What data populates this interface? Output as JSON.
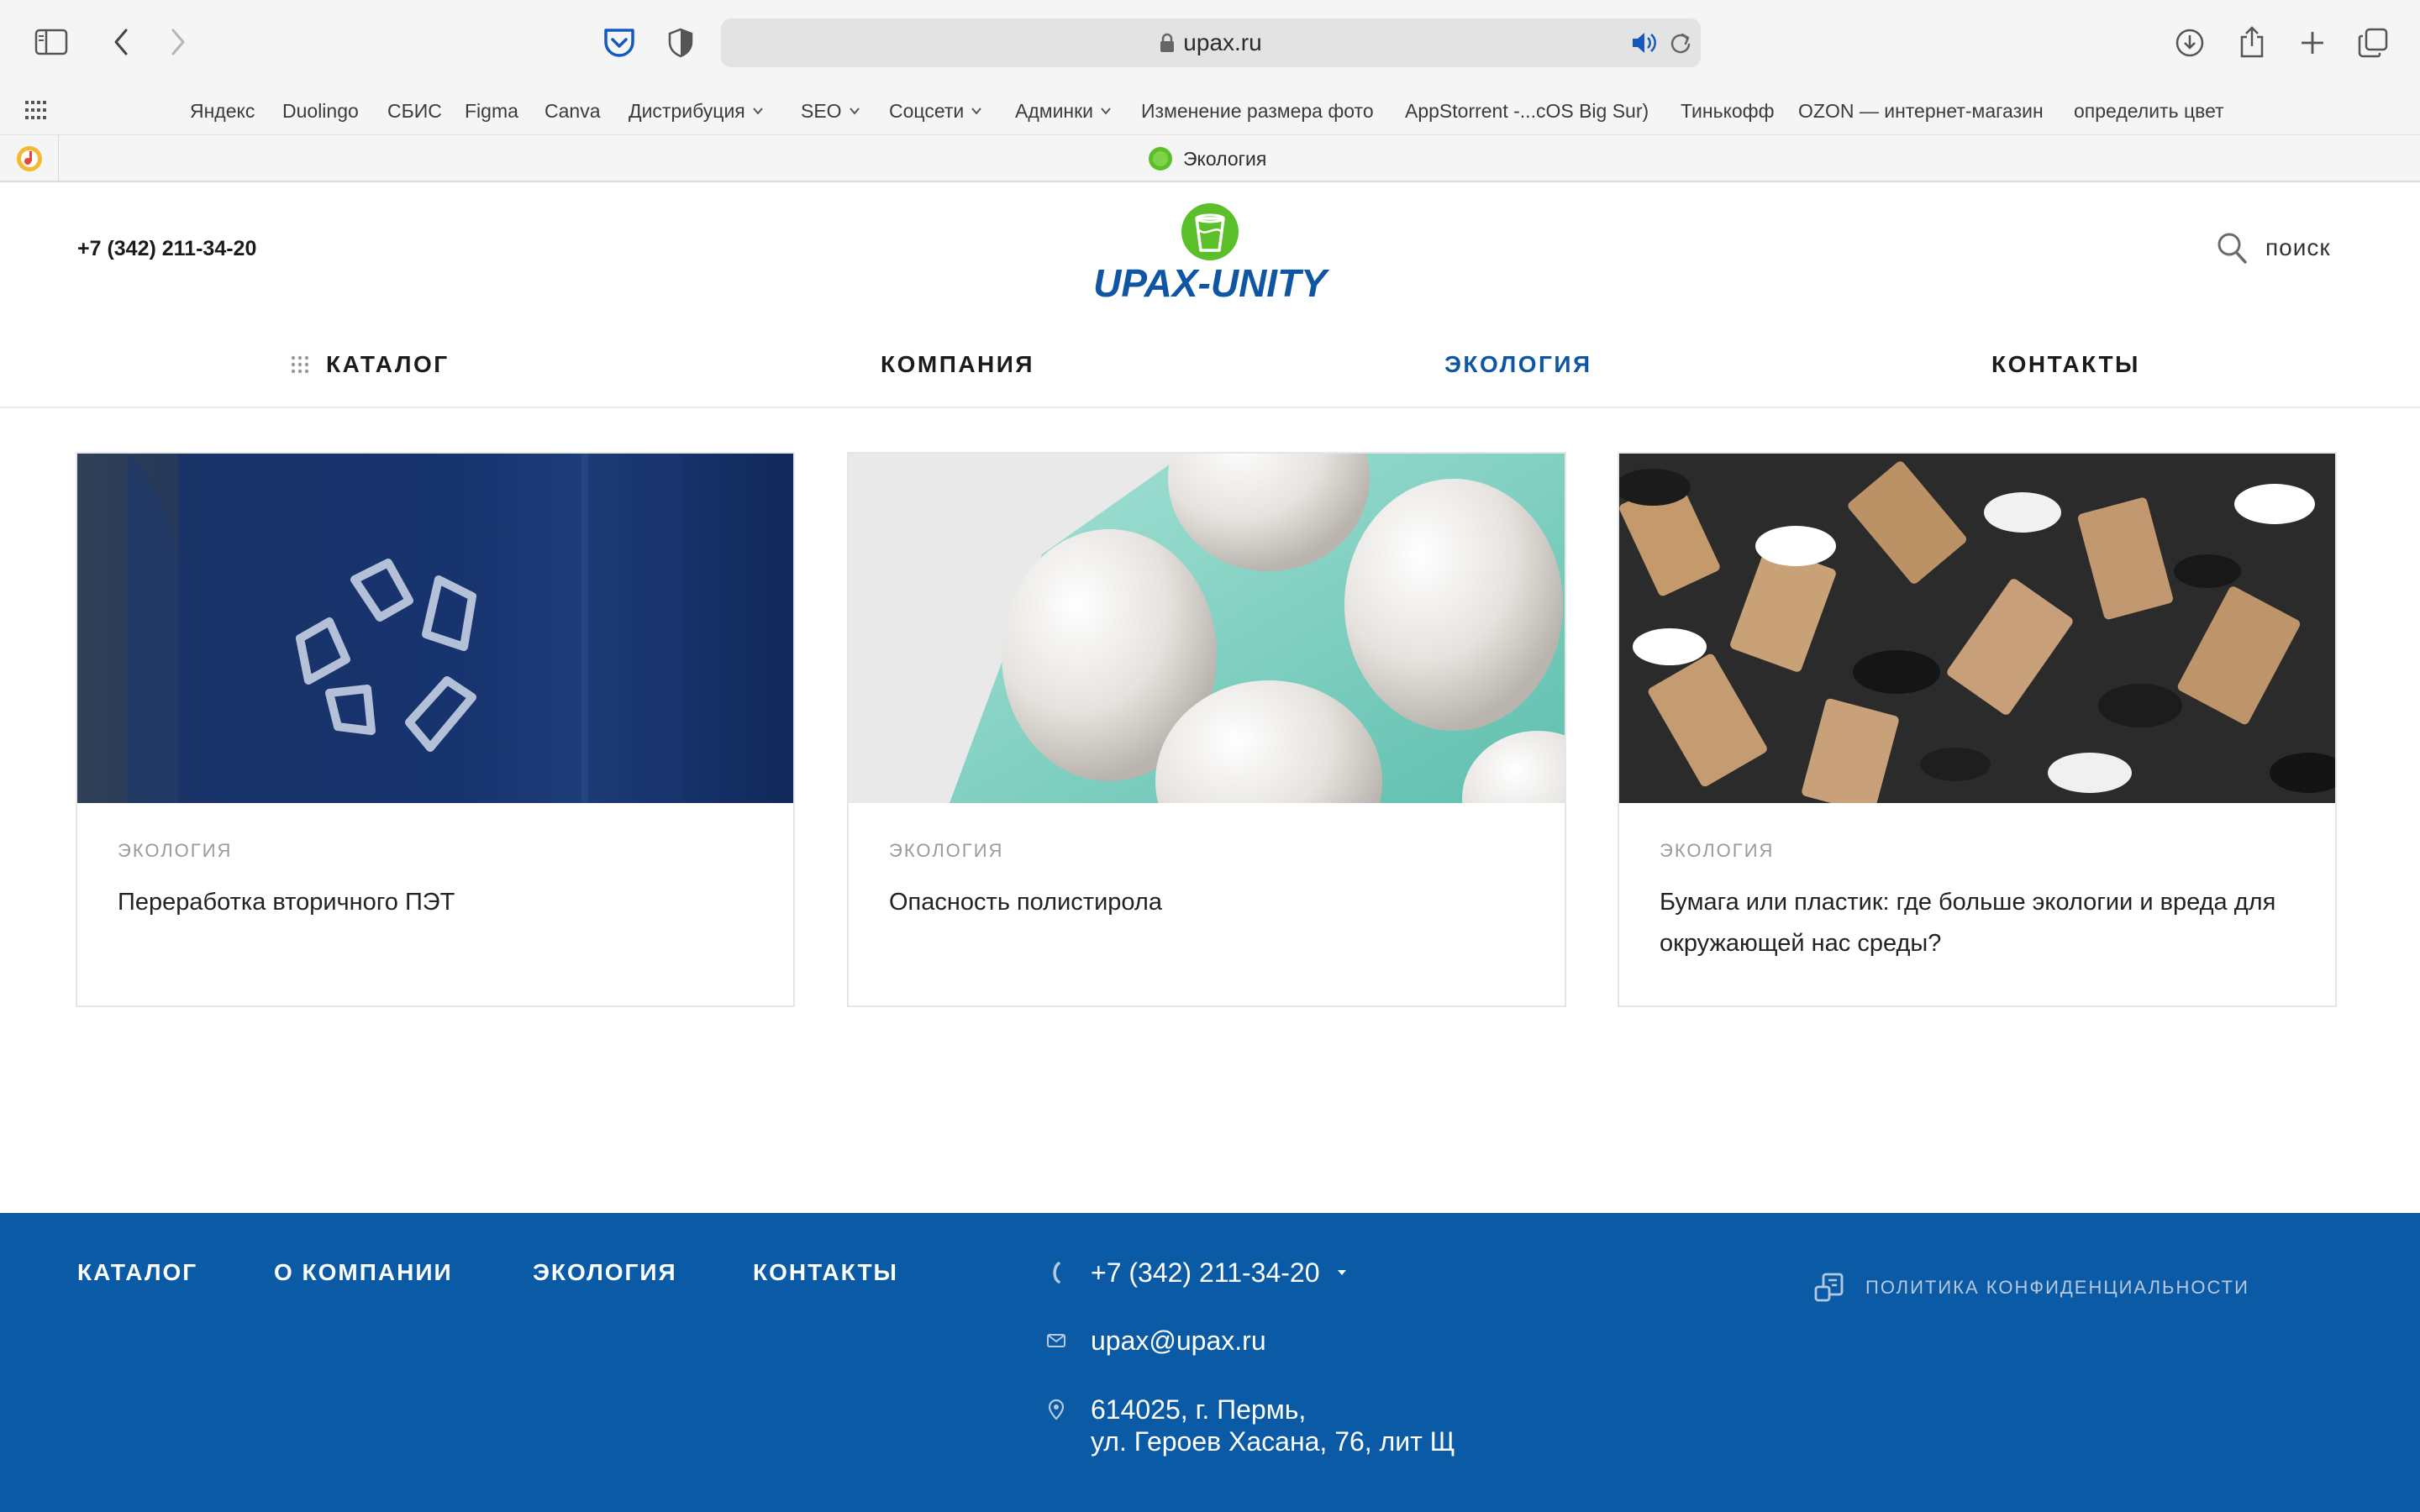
{
  "browser": {
    "url": "upax.ru",
    "bookmarks": [
      {
        "label": "Яндекс",
        "dropdown": false
      },
      {
        "label": "Duolingo",
        "dropdown": false
      },
      {
        "label": "СБИС",
        "dropdown": false
      },
      {
        "label": "Figma",
        "dropdown": false
      },
      {
        "label": "Canva",
        "dropdown": false
      },
      {
        "label": "Дистрибуция",
        "dropdown": true
      },
      {
        "label": "SEO",
        "dropdown": true
      },
      {
        "label": "Соцсети",
        "dropdown": true
      },
      {
        "label": "Админки",
        "dropdown": true
      },
      {
        "label": "Изменение размера фото",
        "dropdown": false
      },
      {
        "label": "AppStorrent -...cOS Big Sur)",
        "dropdown": false
      },
      {
        "label": "Тинькофф",
        "dropdown": false
      },
      {
        "label": "OZON — интернет-магазин",
        "dropdown": false
      },
      {
        "label": "определить цвет",
        "dropdown": false
      }
    ],
    "active_tab": "Экология"
  },
  "header": {
    "phone": "+7 (342) 211-34-20",
    "logo_text": "UPAX-UNITY",
    "search_label": "поиск"
  },
  "nav": [
    {
      "label": "КАТАЛОГ",
      "active": false
    },
    {
      "label": "КОМПАНИЯ",
      "active": false
    },
    {
      "label": "ЭКОЛОГИЯ",
      "active": true
    },
    {
      "label": "КОНТАКТЫ",
      "active": false
    }
  ],
  "cards": [
    {
      "category": "ЭКОЛОГИЯ",
      "title": "Переработка вторичного ПЭТ"
    },
    {
      "category": "ЭКОЛОГИЯ",
      "title": "Опасность полистирола"
    },
    {
      "category": "ЭКОЛОГИЯ",
      "title": "Бумага или пластик: где больше экологии и вреда для окружающей нас среды?"
    }
  ],
  "footer": {
    "nav": [
      "КАТАЛОГ",
      "О КОМПАНИИ",
      "ЭКОЛОГИЯ",
      "КОНТАКТЫ"
    ],
    "phone": "+7 (342) 211-34-20",
    "email": "upax@upax.ru",
    "address_line1": "614025, г. Пермь,",
    "address_line2": "ул. Героев Хасана, 76, лит Щ",
    "privacy": "ПОЛИТИКА КОНФИДЕНЦИАЛЬНОСТИ"
  },
  "colors": {
    "brand_blue": "#0e56a3",
    "footer_bg": "#0a5aa5",
    "logo_green": "#5bbf2a"
  }
}
